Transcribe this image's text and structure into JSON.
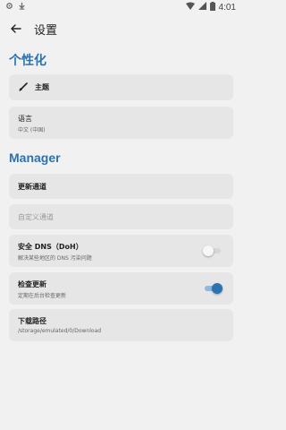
{
  "status": {
    "time": "4:01"
  },
  "appbar": {
    "title": "设置"
  },
  "sections": {
    "personal": "个性化",
    "manager": "Manager"
  },
  "items": {
    "theme": {
      "label": "主题"
    },
    "language": {
      "label": "语言",
      "sub": "中文 (中国)"
    },
    "update_channel": {
      "label": "更新通道"
    },
    "custom_channel": {
      "label": "自定义通道"
    },
    "dns": {
      "label": "安全 DNS（DoH）",
      "sub": "解决某些地区的 DNS 污染问题",
      "enabled": false
    },
    "check_update": {
      "label": "检查更新",
      "sub": "定期在后台检查更新",
      "enabled": true
    },
    "download_path": {
      "label": "下载路径",
      "sub": "/storage/emulated/0/Download"
    }
  },
  "colors": {
    "accent": "#2b72b0",
    "card": "#e6e6e6",
    "background": "#f1f1f1"
  }
}
